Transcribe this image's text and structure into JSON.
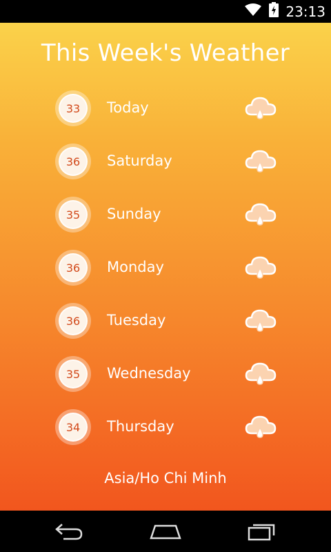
{
  "status_bar": {
    "time": "23:13",
    "icons": [
      "wifi-icon",
      "battery-charging-icon"
    ]
  },
  "colors": {
    "gradient_top": "#fad24a",
    "gradient_bottom": "#f2561e",
    "temp_text": "#d24a1c",
    "circle_fill": "#fdf3e8"
  },
  "title": "This Week's Weather",
  "days": [
    {
      "temp": "33",
      "name": "Today",
      "icon": "cloud-rain-icon"
    },
    {
      "temp": "36",
      "name": "Saturday",
      "icon": "cloud-rain-icon"
    },
    {
      "temp": "35",
      "name": "Sunday",
      "icon": "cloud-rain-icon"
    },
    {
      "temp": "36",
      "name": "Monday",
      "icon": "cloud-rain-icon"
    },
    {
      "temp": "36",
      "name": "Tuesday",
      "icon": "cloud-rain-icon"
    },
    {
      "temp": "35",
      "name": "Wednesday",
      "icon": "cloud-rain-icon"
    },
    {
      "temp": "34",
      "name": "Thursday",
      "icon": "cloud-rain-icon"
    }
  ],
  "location": "Asia/Ho Chi Minh",
  "nav_bar": {
    "icons": [
      "back-icon",
      "home-icon",
      "recents-icon"
    ]
  }
}
